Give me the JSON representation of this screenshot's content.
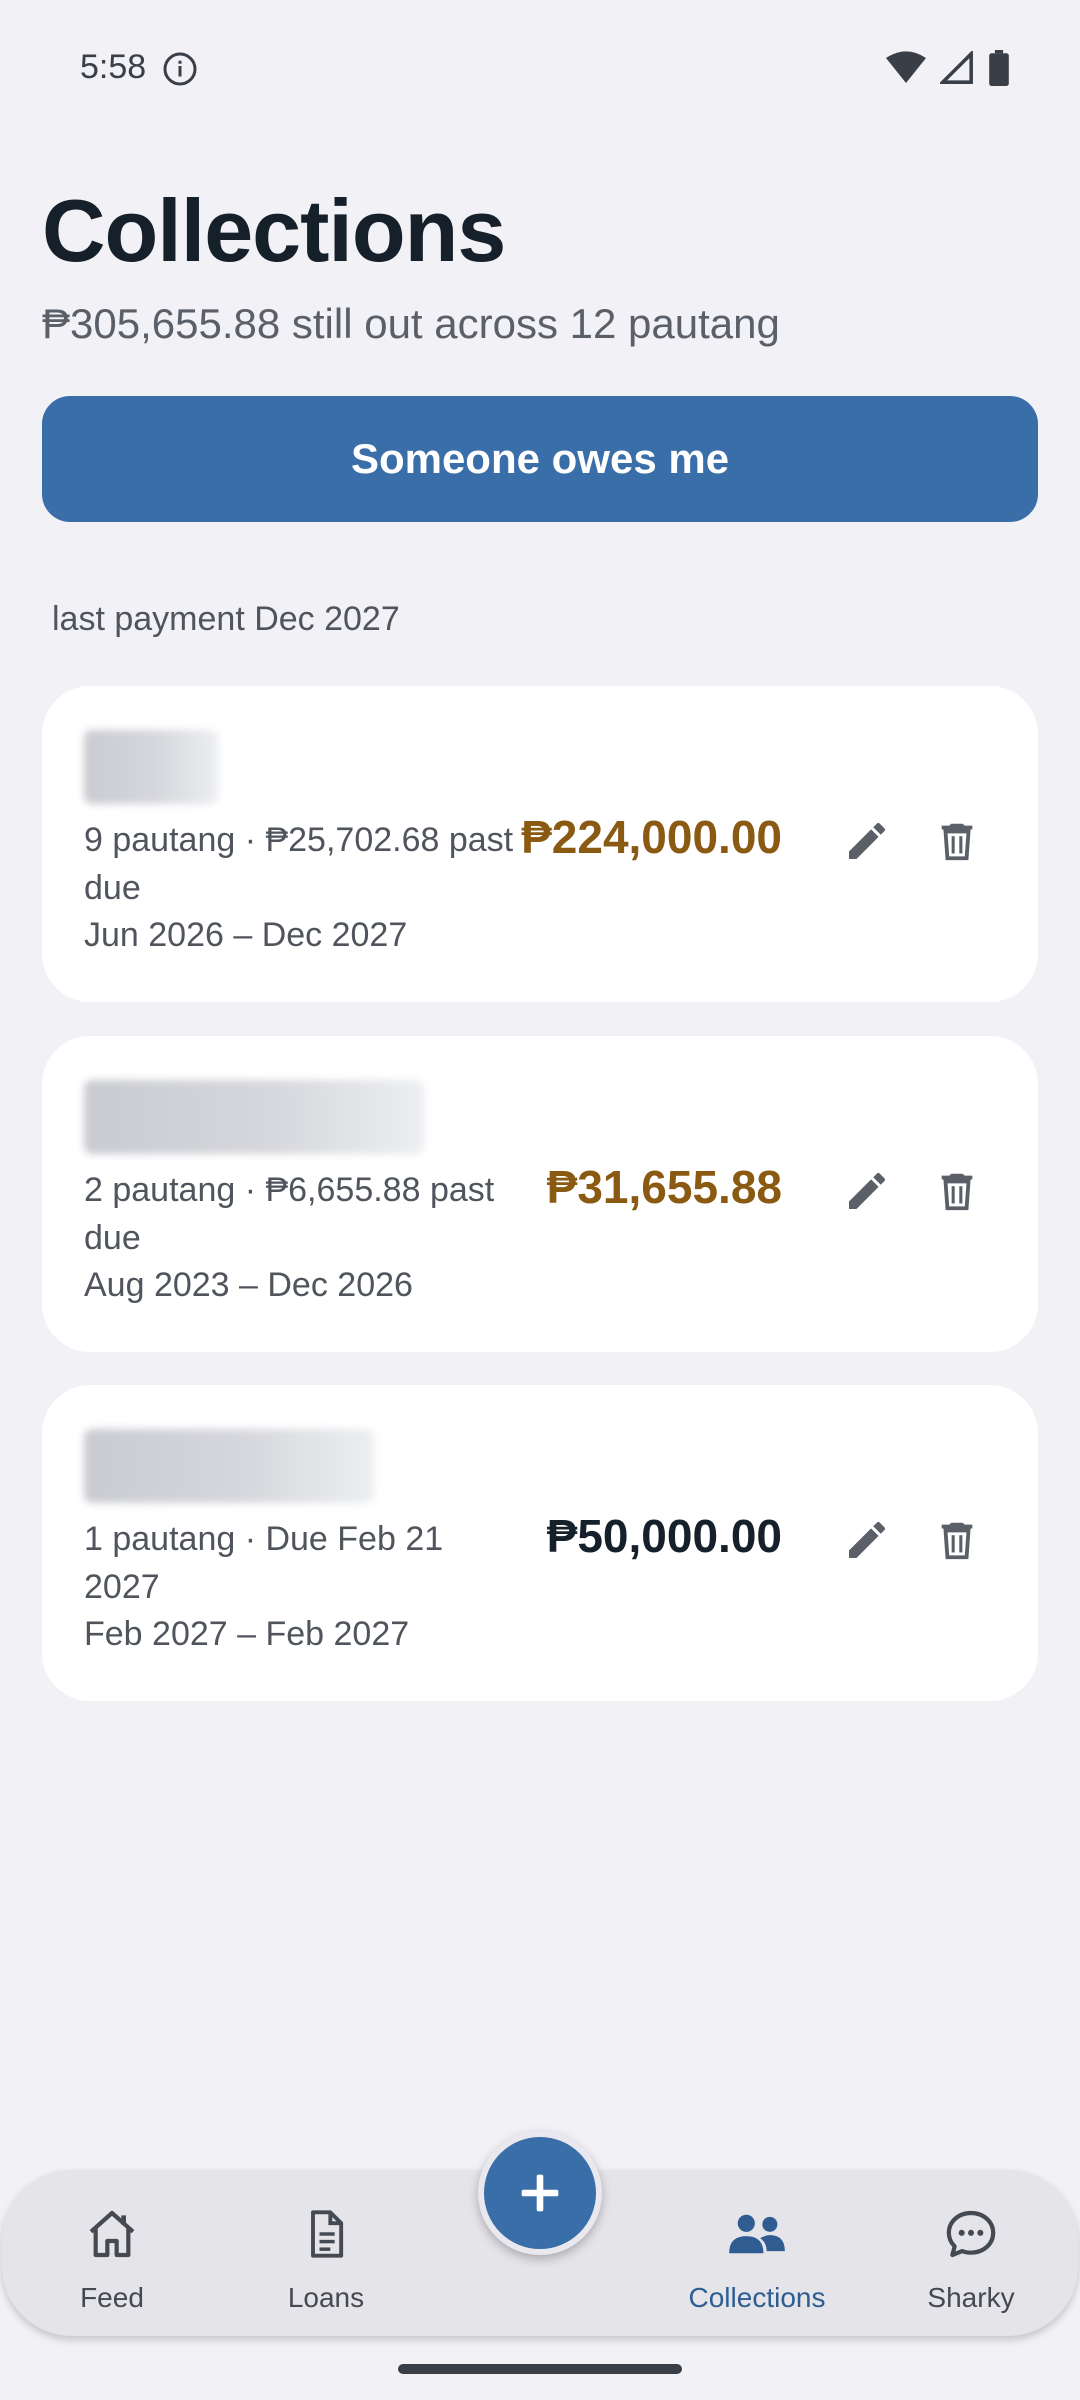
{
  "status_bar": {
    "time": "5:58"
  },
  "header": {
    "title": "Collections",
    "subtitle": "₱305,655.88 still out across 12 pautang",
    "primary_button": "Someone owes me"
  },
  "section_label": "last payment Dec 2027",
  "cards": [
    {
      "meta": "9 pautang · ₱25,702.68 past due",
      "dates": "Jun 2026 – Dec 2027",
      "amount": "₱224,000.00",
      "status": "overdue"
    },
    {
      "meta": "2 pautang · ₱6,655.88 past due",
      "dates": "Aug 2023 – Dec 2026",
      "amount": "₱31,655.88",
      "status": "overdue"
    },
    {
      "meta": "1 pautang · Due Feb 21 2027",
      "dates": "Feb 2027 – Feb 2027",
      "amount": "₱50,000.00",
      "status": "normal"
    }
  ],
  "nav": {
    "items": [
      {
        "label": "Feed",
        "icon": "home-icon",
        "active": false
      },
      {
        "label": "Loans",
        "icon": "document-icon",
        "active": false
      },
      {
        "label": "Collections",
        "icon": "people-icon",
        "active": true
      },
      {
        "label": "Sharky",
        "icon": "chat-bubble-icon",
        "active": false
      }
    ],
    "fab_icon": "plus-icon"
  },
  "colors": {
    "primary": "#3a6ea8",
    "overdue_amount": "#8a5a12",
    "background": "#f1f1f6",
    "card": "#ffffff"
  }
}
